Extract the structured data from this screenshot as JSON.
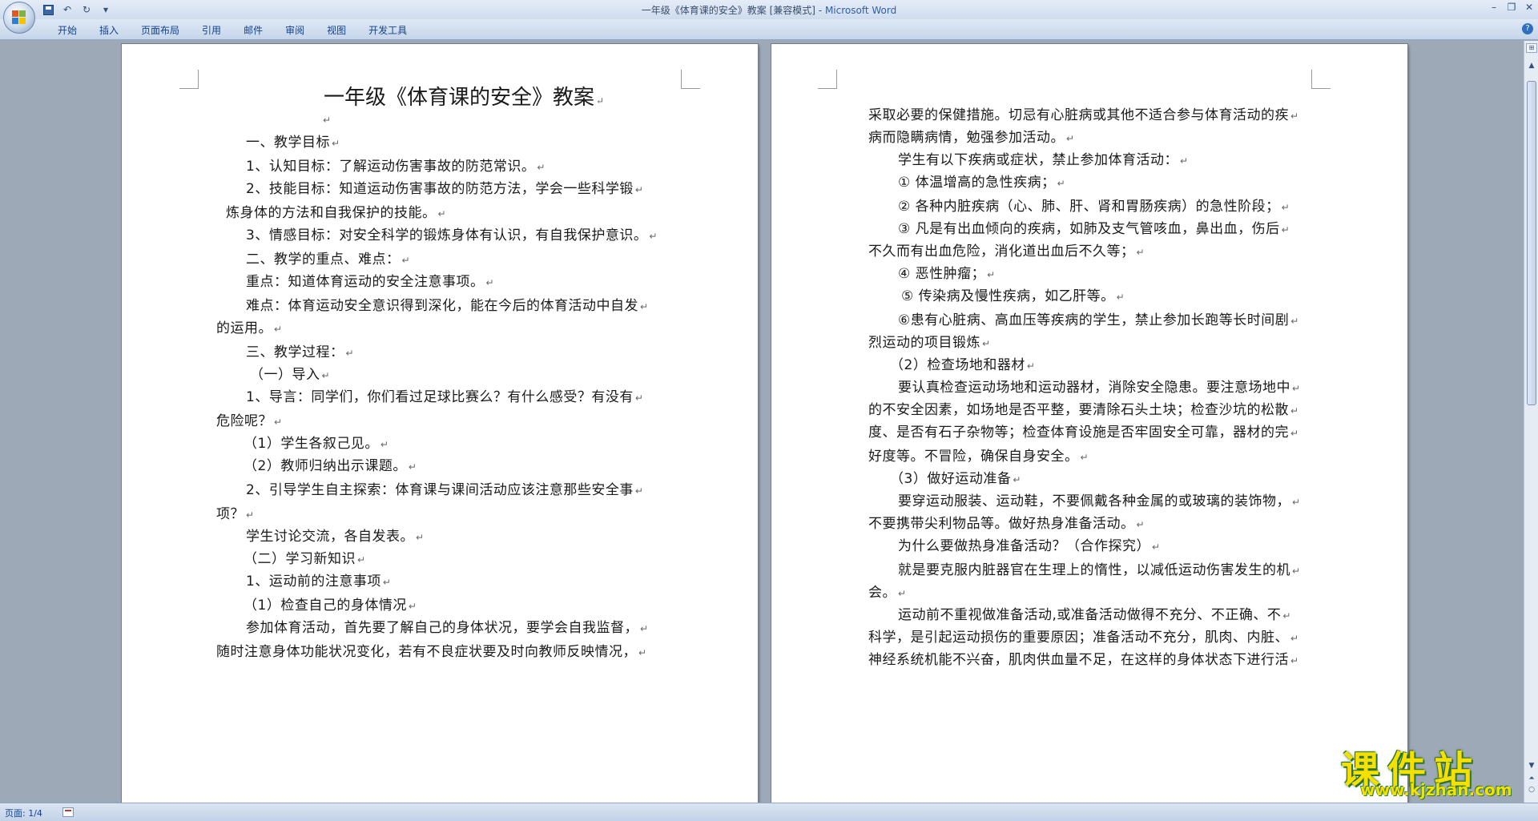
{
  "window": {
    "title_doc": "一年级《体育课的安全》教案 [兼容模式]",
    "title_sep": " - ",
    "title_app": "Microsoft Word",
    "minimize": "–",
    "restore": "❐",
    "close": "✕",
    "help": "?"
  },
  "qat": {
    "undo": "↶",
    "redo": "↻",
    "more": "▾"
  },
  "ribbon": {
    "tabs": [
      "开始",
      "插入",
      "页面布局",
      "引用",
      "邮件",
      "审阅",
      "视图",
      "开发工具"
    ]
  },
  "pilcrow": "↵",
  "doc": {
    "left": {
      "title": "一年级《体育课的安全》教案",
      "lines": [
        "",
        "一、教学目标",
        "1、认知目标：了解运动伤害事故的防范常识。",
        "2、技能目标：知道运动伤害事故的防范方法，学会一些科学锻",
        "炼身体的方法和自我保护的技能。",
        "3、情感目标：对安全科学的锻炼身体有认识，有自我保护意识。",
        "二、教学的重点、难点：",
        "重点：知道体育运动的安全注意事项。",
        "难点：体育运动安全意识得到深化，能在今后的体育活动中自发",
        "的运用。",
        "三、教学过程：",
        "（一）导入",
        "1、导言：同学们，你们看过足球比赛么？有什么感受？有没有",
        "危险呢？",
        "（1）学生各叙己见。",
        "（2）教师归纳出示课题。",
        "2、引导学生自主探索：体育课与课间活动应该注意那些安全事",
        "项？",
        "学生讨论交流，各自发表。",
        "（二）学习新知识",
        "1、运动前的注意事项",
        "（1）检查自己的身体情况",
        "参加体育活动，首先要了解自己的身体状况，要学会自我监督，",
        "随时注意身体功能状况变化，若有不良症状要及时向教师反映情况，"
      ]
    },
    "right": {
      "lines": [
        "采取必要的保健措施。切忌有心脏病或其他不适合参与体育活动的疾",
        "病而隐瞒病情，勉强参加活动。",
        "学生有以下疾病或症状，禁止参加体育活动：",
        "① 体温增高的急性疾病；",
        "② 各种内脏疾病（心、肺、肝、肾和胃肠疾病）的急性阶段；",
        "③ 凡是有出血倾向的疾病，如肺及支气管咳血，鼻出血，伤后",
        "不久而有出血危险，消化道出血后不久等；",
        "④ 恶性肿瘤；",
        "⑤ 传染病及慢性疾病，如乙肝等。",
        "⑥患有心脏病、高血压等疾病的学生，禁止参加长跑等长时间剧",
        "烈运动的项目锻炼",
        "（2）检查场地和器材",
        "要认真检查运动场地和运动器材，消除安全隐患。要注意场地中",
        "的不安全因素，如场地是否平整，要清除石头土块；检查沙坑的松散",
        "度、是否有石子杂物等；检查体育设施是否牢固安全可靠，器材的完",
        "好度等。不冒险，确保自身安全。",
        "（3）做好运动准备",
        "要穿运动服装、运动鞋，不要佩戴各种金属的或玻璃的装饰物，",
        "不要携带尖利物品等。做好热身准备活动。",
        "为什么要做热身准备活动？（合作探究）",
        "就是要克服内脏器官在生理上的惰性，以减低运动伤害发生的机",
        "会。",
        "运动前不重视做准备活动,或准备活动做得不充分、不正确、不",
        "科学，是引起运动损伤的重要原因；准备活动不充分，肌肉、内脏、",
        "神经系统机能不兴奋，肌肉供血量不足，在这样的身体状态下进行活"
      ]
    }
  },
  "status": {
    "page": "页面: 1/4"
  },
  "watermark": {
    "title": "课件站",
    "url": "www.kjzhan.com"
  },
  "colors": {
    "workspace": "#9ea9b8",
    "ribbon_text": "#15428b",
    "watermark": "#f6e000"
  }
}
